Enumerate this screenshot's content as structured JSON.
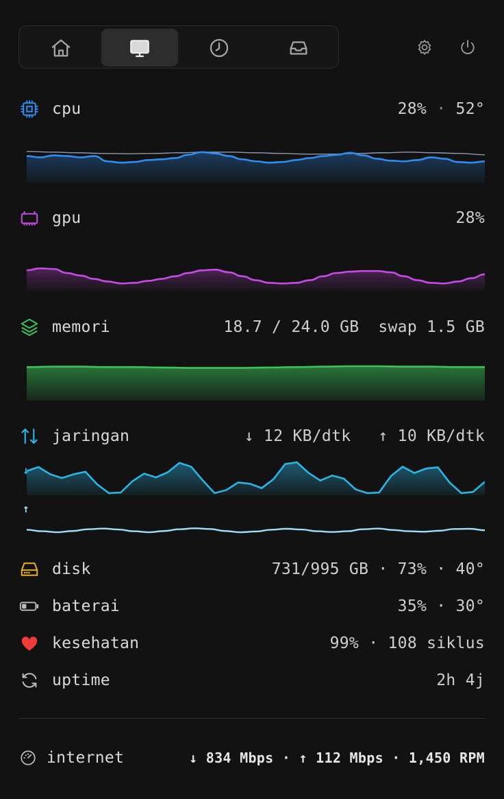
{
  "colors": {
    "cpu": "#2f8cf0",
    "gpu": "#c84be6",
    "memory": "#3cc45a",
    "network": "#2ab6e6",
    "upload": "#9edff5",
    "disk": "#e8b21c",
    "heart": "#ef3b3b"
  },
  "toolbar": {
    "tabs": [
      {
        "icon": "home-icon",
        "active": false
      },
      {
        "icon": "monitor-icon",
        "active": true
      },
      {
        "icon": "clock-icon",
        "active": false
      },
      {
        "icon": "inbox-tray-icon",
        "active": false
      }
    ],
    "settings_icon": "gear-icon",
    "power_icon": "power-icon"
  },
  "cpu": {
    "label": "cpu",
    "usage": "28%",
    "sep": "·",
    "temp": "52°"
  },
  "gpu": {
    "label": "gpu",
    "usage": "28%"
  },
  "memory": {
    "label": "memori",
    "used": "18.7 / 24.0 GB",
    "swap": "swap 1.5 GB"
  },
  "network": {
    "label": "jaringan",
    "down": "↓ 12 KB/dtk",
    "up": "↑ 10 KB/dtk",
    "down_arrow": "↓",
    "up_arrow": "↑"
  },
  "disk": {
    "label": "disk",
    "value": "731/995 GB · 73% · 40°"
  },
  "battery": {
    "label": "baterai",
    "value": "35% · 30°"
  },
  "health": {
    "label": "kesehatan",
    "value": "99% · 108 siklus"
  },
  "uptime": {
    "label": "uptime",
    "value": "2h 4j"
  },
  "footer": {
    "label": "internet",
    "value": "↓ 834 Mbps · ↑ 112 Mbps · 1,450 RPM"
  },
  "series": {
    "cpu": [
      0.78,
      0.74,
      0.8,
      0.78,
      0.74,
      0.78,
      0.62,
      0.58,
      0.6,
      0.66,
      0.68,
      0.72,
      0.82,
      0.9,
      0.86,
      0.78,
      0.68,
      0.62,
      0.58,
      0.6,
      0.66,
      0.72,
      0.78,
      0.82,
      0.88,
      0.8,
      0.7,
      0.64,
      0.62,
      0.66,
      0.74,
      0.7,
      0.6,
      0.58,
      0.62
    ],
    "cpu_avg": [
      0.92,
      0.9,
      0.88,
      0.86,
      0.85,
      0.86,
      0.88,
      0.9,
      0.9,
      0.88,
      0.86,
      0.84,
      0.84,
      0.86,
      0.88,
      0.9,
      0.88,
      0.86,
      0.82
    ],
    "gpu": [
      0.58,
      0.64,
      0.62,
      0.5,
      0.42,
      0.32,
      0.24,
      0.18,
      0.2,
      0.26,
      0.32,
      0.4,
      0.5,
      0.58,
      0.6,
      0.52,
      0.4,
      0.28,
      0.2,
      0.18,
      0.2,
      0.28,
      0.4,
      0.5,
      0.54,
      0.56,
      0.56,
      0.52,
      0.4,
      0.28,
      0.2,
      0.18,
      0.24,
      0.34,
      0.46
    ],
    "memory": [
      0.78,
      0.79,
      0.79,
      0.78,
      0.78,
      0.77,
      0.76,
      0.76,
      0.76,
      0.77,
      0.78,
      0.79,
      0.8,
      0.8,
      0.79,
      0.79,
      0.78,
      0.78
    ],
    "network_down": [
      0.72,
      0.85,
      0.62,
      0.5,
      0.62,
      0.7,
      0.3,
      0.02,
      0.04,
      0.4,
      0.64,
      0.52,
      0.68,
      0.98,
      0.86,
      0.42,
      0.02,
      0.12,
      0.36,
      0.32,
      0.18,
      0.46,
      0.94,
      1.0,
      0.66,
      0.42,
      0.58,
      0.48,
      0.14,
      0.02,
      0.04,
      0.56,
      0.86,
      0.66,
      0.8,
      0.84,
      0.36,
      0.02,
      0.06,
      0.38
    ],
    "network_up": [
      0.42,
      0.3,
      0.22,
      0.32,
      0.46,
      0.52,
      0.44,
      0.3,
      0.22,
      0.32,
      0.46,
      0.54,
      0.48,
      0.32,
      0.22,
      0.28,
      0.42,
      0.5,
      0.44,
      0.3,
      0.24,
      0.3,
      0.46,
      0.52,
      0.4,
      0.3,
      0.26,
      0.34,
      0.48,
      0.5,
      0.38
    ]
  }
}
